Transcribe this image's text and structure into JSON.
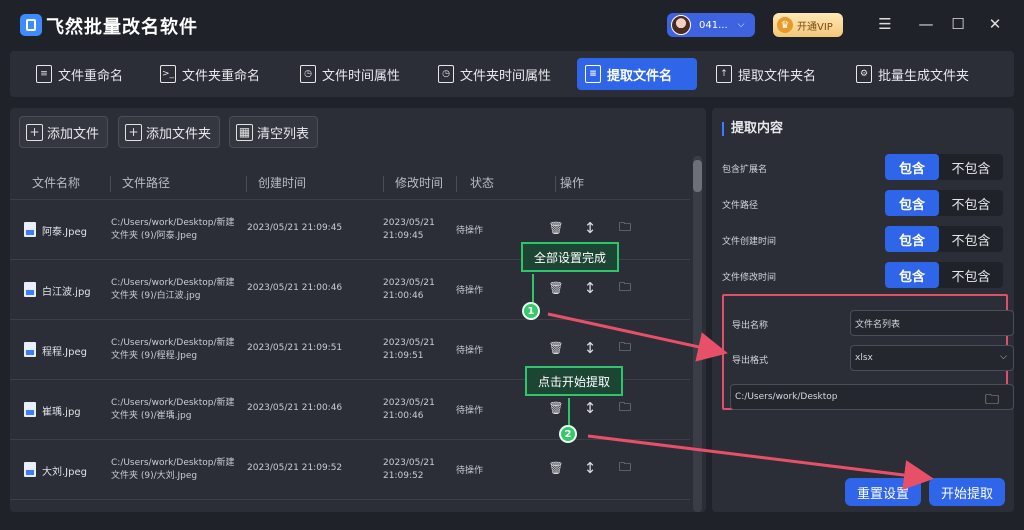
{
  "app": {
    "title": "飞然批量改名软件"
  },
  "header": {
    "user_id": "041...",
    "vip_label": "开通VIP"
  },
  "colors": {
    "accent": "#2f65e8",
    "callout_green": "#2fc56a",
    "highlight_red": "#e0506a"
  },
  "tabs": [
    {
      "label": "文件重命名",
      "icon": "file-rename-icon"
    },
    {
      "label": "文件夹重命名",
      "icon": "folder-rename-icon"
    },
    {
      "label": "文件时间属性",
      "icon": "file-time-icon"
    },
    {
      "label": "文件夹时间属性",
      "icon": "folder-time-icon"
    },
    {
      "label": "提取文件名",
      "icon": "extract-filename-icon",
      "active": true
    },
    {
      "label": "提取文件夹名",
      "icon": "extract-foldername-icon"
    },
    {
      "label": "批量生成文件夹",
      "icon": "generate-folder-icon"
    }
  ],
  "toolbar": {
    "add_file": "添加文件",
    "add_folder": "添加文件夹",
    "clear_list": "清空列表"
  },
  "table": {
    "headers": {
      "name": "文件名称",
      "path": "文件路径",
      "created": "创建时间",
      "modified": "修改时间",
      "status": "状态",
      "action": "操作"
    },
    "rows": [
      {
        "name": "阿泰.Jpeg",
        "path1": "C:/Users/work/Desktop/新建",
        "path2": "文件夹 (9)/阿泰.Jpeg",
        "created": "2023/05/21 21:09:45",
        "mod1": "2023/05/21",
        "mod2": "21:09:45",
        "status": "待操作"
      },
      {
        "name": "白江波.jpg",
        "path1": "C:/Users/work/Desktop/新建",
        "path2": "文件夹 (9)/白江波.jpg",
        "created": "2023/05/21 21:00:46",
        "mod1": "2023/05/21",
        "mod2": "21:00:46",
        "status": "待操作"
      },
      {
        "name": "程程.Jpeg",
        "path1": "C:/Users/work/Desktop/新建",
        "path2": "文件夹 (9)/程程.Jpeg",
        "created": "2023/05/21 21:09:51",
        "mod1": "2023/05/21",
        "mod2": "21:09:51",
        "status": "待操作"
      },
      {
        "name": "崔瑀.jpg",
        "path1": "C:/Users/work/Desktop/新建",
        "path2": "文件夹 (9)/崔瑀.jpg",
        "created": "2023/05/21 21:00:46",
        "mod1": "2023/05/21",
        "mod2": "21:00:46",
        "status": "待操作"
      },
      {
        "name": "大刘.Jpeg",
        "path1": "C:/Users/work/Desktop/新建",
        "path2": "文件夹 (9)/大刘.Jpeg",
        "created": "2023/05/21 21:09:52",
        "mod1": "2023/05/21",
        "mod2": "21:09:52",
        "status": "待操作"
      }
    ]
  },
  "panel": {
    "title": "提取内容",
    "options": [
      {
        "label": "包含扩展名",
        "on": "包含",
        "off": "不包含"
      },
      {
        "label": "文件路径",
        "on": "包含",
        "off": "不包含"
      },
      {
        "label": "文件创建时间",
        "on": "包含",
        "off": "不包含"
      },
      {
        "label": "文件修改时间",
        "on": "包含",
        "off": "不包含"
      }
    ],
    "output_name_label": "导出名称",
    "output_name_value": "文件名列表",
    "output_format_label": "导出格式",
    "output_format_value": "xlsx",
    "output_path": "C:/Users/work/Desktop",
    "reset_label": "重置设置",
    "start_label": "开始提取"
  },
  "callouts": [
    {
      "text": "全部设置完成",
      "number": "1"
    },
    {
      "text": "点击开始提取",
      "number": "2"
    }
  ]
}
